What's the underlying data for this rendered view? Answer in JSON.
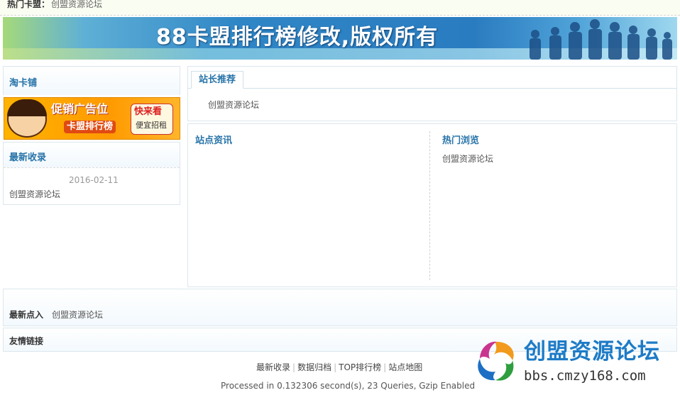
{
  "topbar": {
    "label": "热门卡盟：",
    "value": "创盟资源论坛"
  },
  "banner": {
    "title": "88卡盟排行榜修改,版权所有"
  },
  "left": {
    "taokapu": {
      "title": "淘卡铺"
    },
    "ad": {
      "line1": "促销广告位",
      "line2": "卡盟排行榜",
      "badge1": "快来看",
      "badge2": "便宜招租"
    },
    "newest": {
      "title": "最新收录",
      "date": "2016-02-11",
      "item": "创盟资源论坛"
    }
  },
  "recommend": {
    "tab": "站长推荐",
    "item": "创盟资源论坛"
  },
  "news": {
    "title": "站点资讯"
  },
  "hot": {
    "title": "热门浏览",
    "item": "创盟资源论坛"
  },
  "latest_click": {
    "label": "最新点入",
    "item": "创盟资源论坛"
  },
  "friend_links": {
    "title": "友情链接"
  },
  "footer": {
    "links": [
      "最新收录",
      "数据归档",
      "TOP排行榜",
      "站点地图"
    ],
    "processed": "Processed in 0.132306 second(s), 23 Queries, Gzip Enabled"
  },
  "watermark": {
    "name": "创盟资源论坛",
    "url": "bbs.cmzy168.com"
  },
  "colors": {
    "accent": "#2773a8",
    "border": "#dbe7ee",
    "banner": "#2a7cc0"
  }
}
